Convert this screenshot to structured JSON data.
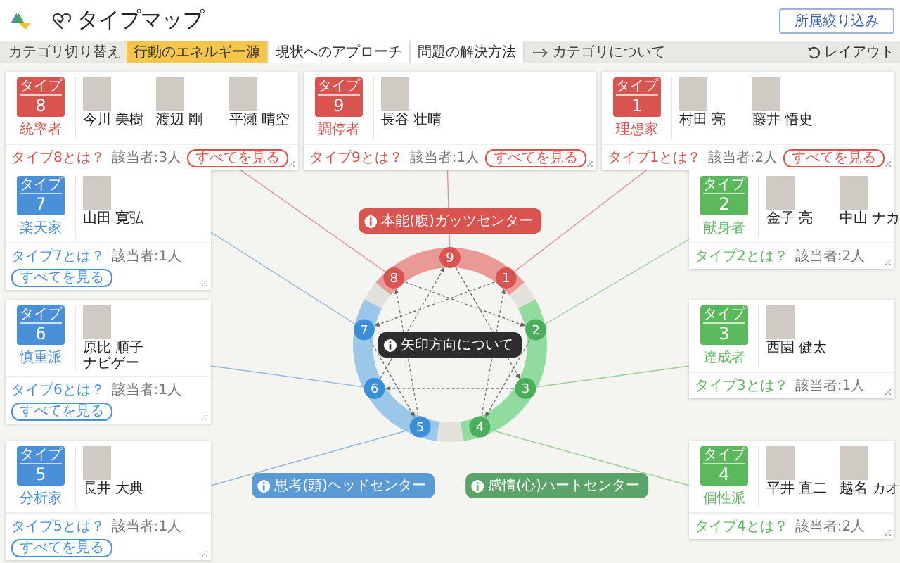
{
  "header": {
    "title": "タイプマップ",
    "filter_button": "所属絞り込み"
  },
  "category_bar": {
    "label": "カテゴリ切り替え",
    "tabs": [
      {
        "label": "行動のエネルギー源",
        "selected": true
      },
      {
        "label": "現状へのアプローチ",
        "selected": false
      },
      {
        "label": "問題の解決方法",
        "selected": false
      }
    ],
    "about_link": "カテゴリについて",
    "layout_button": "レイアウト"
  },
  "types": [
    {
      "type_label": "タイプ",
      "number": "8",
      "name": "統率者",
      "color": "#d9534f",
      "people": [
        "今川 美樹",
        "渡辺 剛",
        "平瀬 晴空"
      ],
      "about": "タイプ8とは？",
      "count": "該当者:3人",
      "see_all": "すべてを見る"
    },
    {
      "type_label": "タイプ",
      "number": "9",
      "name": "調停者",
      "color": "#d9534f",
      "people": [
        "長谷 壮晴"
      ],
      "about": "タイプ9とは？",
      "count": "該当者:1人",
      "see_all": "すべてを見る"
    },
    {
      "type_label": "タイプ",
      "number": "1",
      "name": "理想家",
      "color": "#d9534f",
      "people": [
        "村田 亮",
        "藤井 悟史"
      ],
      "about": "タイプ1とは？",
      "count": "該当者:2人",
      "see_all": "すべてを見る"
    },
    {
      "type_label": "タイプ",
      "number": "7",
      "name": "楽天家",
      "color": "#4a90d9",
      "people": [
        "山田 寛弘"
      ],
      "about": "タイプ7とは？",
      "count": "該当者:1人",
      "see_all": "すべてを見る"
    },
    {
      "type_label": "タイプ",
      "number": "6",
      "name": "慎重派",
      "color": "#4a90d9",
      "people": [
        "原比 順子ナビゲー"
      ],
      "about": "タイプ6とは？",
      "count": "該当者:1人",
      "see_all": "すべてを見る"
    },
    {
      "type_label": "タイプ",
      "number": "5",
      "name": "分析家",
      "color": "#4a90d9",
      "people": [
        "長井 大典"
      ],
      "about": "タイプ5とは？",
      "count": "該当者:1人",
      "see_all": "すべてを見る"
    },
    {
      "type_label": "タイプ",
      "number": "2",
      "name": "献身者",
      "color": "#5cb85c",
      "people": [
        "金子 亮",
        "中山 ナカ"
      ],
      "about": "タイプ2とは？",
      "count": "該当者:2人"
    },
    {
      "type_label": "タイプ",
      "number": "3",
      "name": "達成者",
      "color": "#5cb85c",
      "people": [
        "西園 健太"
      ],
      "about": "タイプ3とは？",
      "count": "該当者:1人"
    },
    {
      "type_label": "タイプ",
      "number": "4",
      "name": "個性派",
      "color": "#5cb85c",
      "people": [
        "平井 直二",
        "越名 カオ"
      ],
      "about": "タイプ4とは？",
      "count": "該当者:2人"
    }
  ],
  "diagram": {
    "nodes": [
      {
        "label": "9",
        "color": "#d9534f"
      },
      {
        "label": "1",
        "color": "#d9534f"
      },
      {
        "label": "2",
        "color": "#4cae5a"
      },
      {
        "label": "3",
        "color": "#4cae5a"
      },
      {
        "label": "4",
        "color": "#4cae5a"
      },
      {
        "label": "5",
        "color": "#3b8fd8"
      },
      {
        "label": "6",
        "color": "#3b8fd8"
      },
      {
        "label": "7",
        "color": "#3b8fd8"
      },
      {
        "label": "8",
        "color": "#d9534f"
      }
    ],
    "centers": [
      {
        "label": "本能(腹)ガッツセンター",
        "color": "#d9534f"
      },
      {
        "label": "思考(頭)ヘッドセンター",
        "color": "#5b9bd5"
      },
      {
        "label": "感情(心)ハートセンター",
        "color": "#5aa469"
      }
    ],
    "arrow_note": "矢印方向について"
  }
}
